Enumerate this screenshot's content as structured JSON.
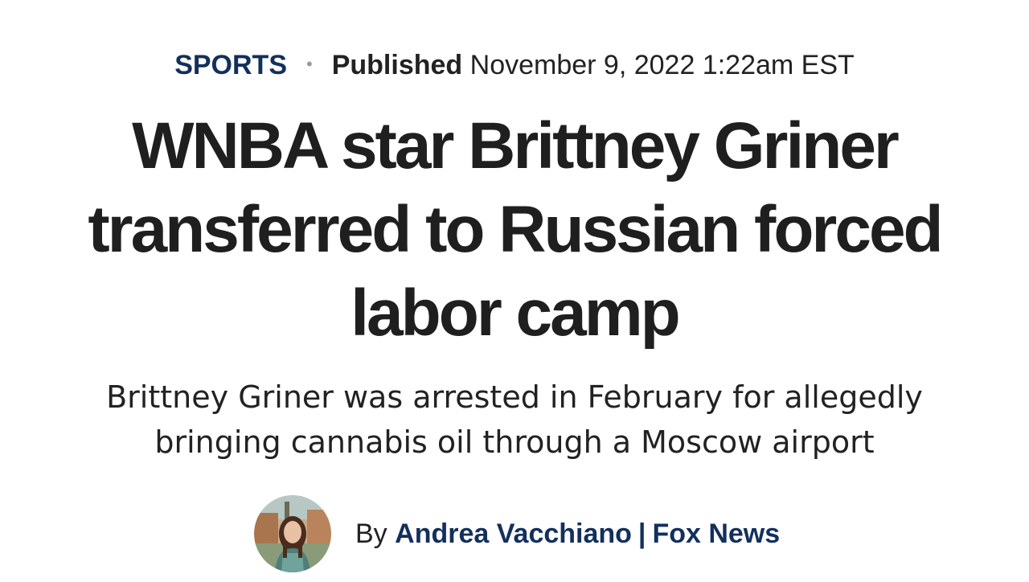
{
  "eyebrow": {
    "category": "SPORTS",
    "separator": "•",
    "published_label": "Published",
    "published_date": "November 9, 2022 1:22am EST"
  },
  "headline": {
    "line1": "WNBA star Brittney Griner",
    "line2": "transferred to Russian forced",
    "line3": "labor camp"
  },
  "dek": {
    "line1": "Brittney Griner was arrested in February for allegedly",
    "line2": "bringing cannabis oil through a Moscow airport"
  },
  "byline": {
    "prefix": "By",
    "author": "Andrea Vacchiano",
    "separator": "|",
    "outlet": "Fox News"
  },
  "colors": {
    "accent_navy": "#13305c",
    "text": "#222222"
  },
  "icons": {
    "author_avatar": "author-avatar-photo"
  }
}
